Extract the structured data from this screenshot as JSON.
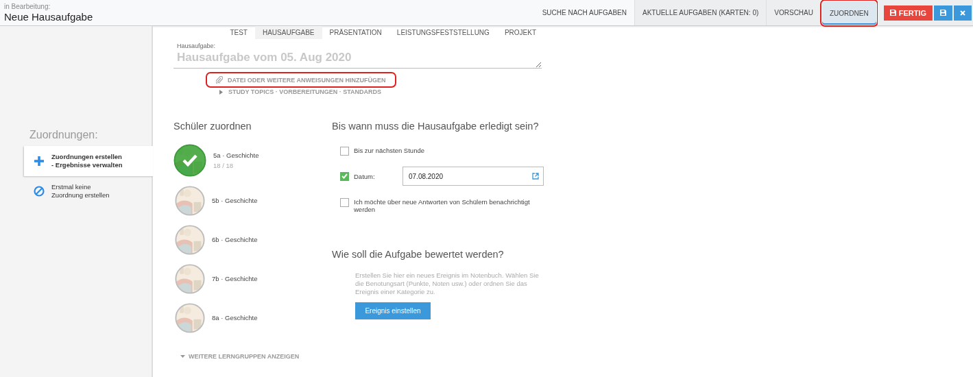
{
  "header": {
    "status": "in Bearbeitung:",
    "title": "Neue Hausaufgabe",
    "nav": [
      {
        "label": "SUCHE NACH AUFGABEN",
        "selected": false,
        "shaded": false,
        "highlighted": false
      },
      {
        "label": "AKTUELLE AUFGABEN (KARTEN: 0)",
        "selected": false,
        "shaded": true,
        "highlighted": false
      },
      {
        "label": "VORSCHAU",
        "selected": false,
        "shaded": true,
        "highlighted": false
      },
      {
        "label": "ZUORDNEN",
        "selected": true,
        "shaded": true,
        "highlighted": true
      }
    ],
    "buttons": [
      {
        "kind": "done",
        "label": "FERTIG"
      },
      {
        "kind": "save"
      },
      {
        "kind": "close"
      }
    ]
  },
  "sidebar": {
    "heading": "Zuordnungen:",
    "items": [
      {
        "kind": "add",
        "lines": [
          "Zuordnungen erstellen",
          "- Ergebnisse verwalten"
        ],
        "selected": true
      },
      {
        "kind": "none",
        "lines": [
          "Erstmal keine",
          "Zuordnung erstellen"
        ],
        "selected": false
      }
    ]
  },
  "type_tabs": [
    {
      "label": "TEST",
      "selected": false
    },
    {
      "label": "HAUSAUFGABE",
      "selected": true
    },
    {
      "label": "PRÄSENTATION",
      "selected": false
    },
    {
      "label": "LEISTUNGSFESTSTELLUNG",
      "selected": false
    },
    {
      "label": "PROJEKT",
      "selected": false
    }
  ],
  "task": {
    "label": "Hausaufgabe:",
    "placeholder": "Hausaufgabe vom 05. Aug 2020",
    "attach": {
      "label": "DATEI ODER WEITERE ANWEISUNGEN HINZUFÜGEN",
      "highlighted": true
    },
    "topics": {
      "label": "STUDY TOPICS · VORBEREITUNGEN · STANDARDS",
      "expanded": false
    }
  },
  "students": {
    "heading": "Schüler zuordnen",
    "groups": [
      {
        "name": "5a · Geschichte",
        "count": "18 / 18",
        "selected": true
      },
      {
        "name": "5b · Geschichte",
        "selected": false
      },
      {
        "name": "6b · Geschichte",
        "selected": false
      },
      {
        "name": "7b · Geschichte",
        "selected": false
      },
      {
        "name": "8a · Geschichte",
        "selected": false
      }
    ],
    "more": {
      "label": "WEITERE LERNGRUPPEN ANZEIGEN",
      "expanded": false
    }
  },
  "due": {
    "heading": "Bis wann muss die Hausaufgabe erledigt sein?",
    "options": [
      {
        "kind": "check",
        "label": "Bis zur nächsten Stunde",
        "checked": false
      },
      {
        "kind": "date",
        "label": "Datum:",
        "checked": true,
        "value": "07.08.2020"
      },
      {
        "kind": "check",
        "label": "Ich möchte über neue Antworten von Schülern benachrichtigt werden",
        "checked": false
      }
    ]
  },
  "grading": {
    "heading": "Wie soll die Aufgabe bewertet werden?",
    "text": "Erstellen Sie hier ein neues Ereignis im Notenbuch. Wählen Sie die Benotungsart (Punkte, Noten usw.) oder ordnen Sie das Ereignis einer Kategorie zu.",
    "button": "Ereignis einstellen"
  }
}
